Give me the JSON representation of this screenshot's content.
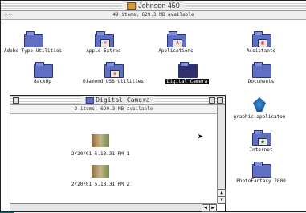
{
  "window": {
    "title": "Johnson 450",
    "status": "49 items, 629.3 MB available",
    "view_icon": "⁘⁘",
    "items": [
      {
        "name": "Adobe Type Utilities",
        "icon": "folder-icon"
      },
      {
        "name": "Apple Extras",
        "icon": "folder-icon"
      },
      {
        "name": "Applications",
        "icon": "folder-icon"
      },
      {
        "name": "Assistants",
        "icon": "folder-icon"
      },
      {
        "name": "BackUp",
        "icon": "folder-icon"
      },
      {
        "name": "Diamond USB Utilities",
        "icon": "folder-icon"
      },
      {
        "name": "Digital Camera",
        "icon": "folder-icon",
        "selected": true
      },
      {
        "name": "Documents",
        "icon": "folder-icon"
      },
      {
        "name": "graphic applicaton",
        "icon": "app-icon"
      },
      {
        "name": "Internet",
        "icon": "folder-icon"
      },
      {
        "name": "PhotoFantasy 2000",
        "icon": "folder-icon"
      }
    ]
  },
  "subwindow": {
    "title": "Digital Camera",
    "status": "2 items, 629.3 MB available",
    "files": [
      {
        "name": "2/20/01 5.18.31 PM 1"
      },
      {
        "name": "2/20/01 5.18.31 PM 2"
      }
    ]
  },
  "colors": {
    "folder": "#5e6fc4",
    "selected_folder": "#2d2f6e",
    "desktop": "#0b6b6b"
  }
}
